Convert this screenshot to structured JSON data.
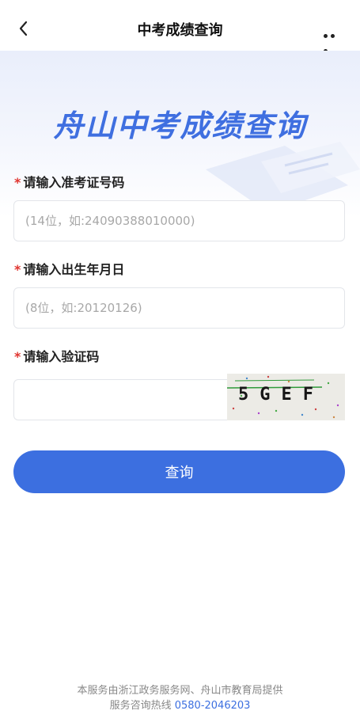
{
  "nav": {
    "title": "中考成绩查询"
  },
  "banner": {
    "title": "舟山中考成绩查询"
  },
  "form": {
    "exam_id": {
      "required_mark": "*",
      "label": "请输入准考证号码",
      "placeholder": "(14位，如:24090388010000)"
    },
    "birth_date": {
      "required_mark": "*",
      "label": "请输入出生年月日",
      "placeholder": "(8位，如:20120126)"
    },
    "captcha": {
      "required_mark": "*",
      "label": "请输入验证码",
      "value": "",
      "image_text": "5GEF"
    }
  },
  "submit_label": "查询",
  "footer": {
    "line1": "本服务由浙江政务服务网、舟山市教育局提供",
    "hotline_label": "服务咨询热线",
    "hotline_number": "0580-2046203"
  },
  "colors": {
    "accent": "#3c6fe0",
    "required": "#e0342f"
  }
}
